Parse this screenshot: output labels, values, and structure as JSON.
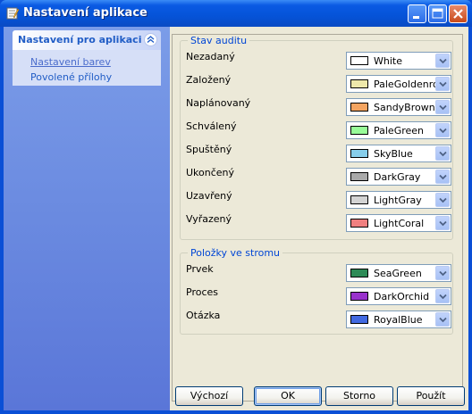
{
  "window": {
    "title": "Nastavení aplikace"
  },
  "sidebar": {
    "group_title": "Nastavení pro aplikaci",
    "items": [
      {
        "label": "Nastavení barev",
        "active": true
      },
      {
        "label": "Povolené přílohy",
        "active": false
      }
    ]
  },
  "audit": {
    "legend": "Stav auditu",
    "rows": [
      {
        "label": "Nezadaný",
        "color_name": "White",
        "color": "#FFFFFF"
      },
      {
        "label": "Založený",
        "color_name": "PaleGoldenrod",
        "color": "#EEE8AA"
      },
      {
        "label": "Naplánovaný",
        "color_name": "SandyBrown",
        "color": "#F4A460"
      },
      {
        "label": "Schválený",
        "color_name": "PaleGreen",
        "color": "#98FB98"
      },
      {
        "label": "Spuštěný",
        "color_name": "SkyBlue",
        "color": "#87CEEB"
      },
      {
        "label": "Ukončený",
        "color_name": "DarkGray",
        "color": "#A9A9A9"
      },
      {
        "label": "Uzavřený",
        "color_name": "LightGray",
        "color": "#D3D3D3"
      },
      {
        "label": "Vyřazený",
        "color_name": "LightCoral",
        "color": "#F08080"
      }
    ]
  },
  "tree": {
    "legend": "Položky ve stromu",
    "rows": [
      {
        "label": "Prvek",
        "color_name": "SeaGreen",
        "color": "#2E8B57"
      },
      {
        "label": "Proces",
        "color_name": "DarkOrchid",
        "color": "#9932CC"
      },
      {
        "label": "Otázka",
        "color_name": "RoyalBlue",
        "color": "#4169E1"
      }
    ]
  },
  "buttons": {
    "default": "Výchozí",
    "ok": "OK",
    "cancel": "Storno",
    "apply": "Použít"
  }
}
